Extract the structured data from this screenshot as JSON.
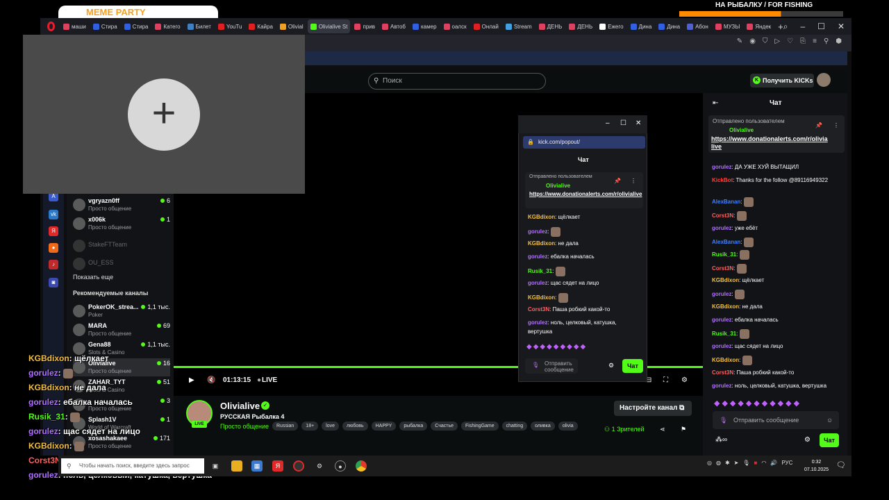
{
  "overlay": {
    "meme_party": "MEME PARTY",
    "fishing_label": "НА РЫБАЛКУ / FOR FISHING",
    "fishing_progress": 0.62
  },
  "browser": {
    "tabs": [
      {
        "label": "маши",
        "color": "#e04060"
      },
      {
        "label": "Стира",
        "color": "#3060e0"
      },
      {
        "label": "Стира",
        "color": "#3060e0"
      },
      {
        "label": "Катего",
        "color": "#e04060"
      },
      {
        "label": "Билет",
        "color": "#4080c0"
      },
      {
        "label": "YouTu",
        "color": "#e02020"
      },
      {
        "label": "Кайра",
        "color": "#e02020"
      },
      {
        "label": "Olivial",
        "color": "#f0a020"
      },
      {
        "label": "Olivialive St",
        "color": "#53fc18"
      },
      {
        "label": "прив",
        "color": "#e04060"
      },
      {
        "label": "Автоб",
        "color": "#e04060"
      },
      {
        "label": "камер",
        "color": "#3060e0"
      },
      {
        "label": "оалск",
        "color": "#e04060"
      },
      {
        "label": "Онлай",
        "color": "#e02020"
      },
      {
        "label": "Stream",
        "color": "#40a0e0"
      },
      {
        "label": "ДЕНЬ",
        "color": "#e04060"
      },
      {
        "label": "ДЕНЬ",
        "color": "#e04060"
      },
      {
        "label": "Ежего",
        "color": "#ffffff"
      },
      {
        "label": "Дина",
        "color": "#3060e0"
      },
      {
        "label": "Дина",
        "color": "#3060e0"
      },
      {
        "label": "Абон",
        "color": "#5060d0"
      },
      {
        "label": "МУЗЫ",
        "color": "#e04060"
      },
      {
        "label": "Яндек",
        "color": "#e04060"
      }
    ],
    "new_tab": "+"
  },
  "header": {
    "search_placeholder": "Поиск",
    "get_kicks": "Получить KICKs"
  },
  "sidebar": {
    "channels_top": [
      {
        "name": "vgryazn0ff",
        "cat": "Просто общение",
        "count": "6"
      },
      {
        "name": "x006k",
        "cat": "Просто общение",
        "count": "1"
      }
    ],
    "offline": [
      "StakeFTTeam",
      "OU_ESS"
    ],
    "show_more": "Показать еще",
    "recommended_title": "Рекомендуемые каналы",
    "recommended": [
      {
        "name": "PokerOK_strea...",
        "cat": "Poker",
        "count": "1,1 тыс."
      },
      {
        "name": "MARA",
        "cat": "Просто общение",
        "count": "69"
      },
      {
        "name": "Gena88",
        "cat": "Slots & Casino",
        "count": "1,1 тыс."
      },
      {
        "name": "Olivialive",
        "cat": "Просто общение",
        "count": "16"
      },
      {
        "name": "ZAHAR_TYT",
        "cat": "Slots & Casino",
        "count": "51"
      },
      {
        "name": "",
        "cat": "Просто общение",
        "count": "3"
      },
      {
        "name": "Splash1V",
        "cat": "World of Warcraft",
        "count": "1"
      },
      {
        "name": "xosashakaee",
        "cat": "Просто общение",
        "count": "171"
      }
    ]
  },
  "player": {
    "time": "01:13:15",
    "live": "LIVE"
  },
  "channel": {
    "name": "Olivialive",
    "title": "РУССКАЯ Рыбалка 4",
    "category": "Просто общение",
    "tags": [
      "Russian",
      "18+",
      "love",
      "любовь",
      "HAPPY",
      "рыбалка",
      "Счастье",
      "FishingGame",
      "chatting",
      "оливка",
      "olivia"
    ],
    "setup_button": "Настройте канал",
    "viewers": "1 Зрителей",
    "live_badge": "LIVE"
  },
  "popout": {
    "url": "kick.com/popout/",
    "chat_title": "Чат",
    "pinned_by": "Отправлено пользователем",
    "pinned_user": "Olivialive",
    "pinned_link": "https://www.donationalerts.com/r/olivialive",
    "messages": [
      {
        "user": "KGBdixon",
        "color": "#f4c040",
        "text": ": щёлкает"
      },
      {
        "user": "gorulez",
        "color": "#b070ff",
        "text": ":"
      },
      {
        "user": "KGBdixon",
        "color": "#f4c040",
        "text": ": не дала"
      },
      {
        "user": "gorulez",
        "color": "#b070ff",
        "text": ": ебалка началась"
      },
      {
        "user": "Rusik_31",
        "color": "#53fc18",
        "text": ":"
      },
      {
        "user": "gorulez",
        "color": "#b070ff",
        "text": ": щас сядет на лицо"
      },
      {
        "user": "KGBdixon",
        "color": "#f4c040",
        "text": ":"
      },
      {
        "user": "Corst3N",
        "color": "#ff6060",
        "text": ": Паша робкий какой-то"
      },
      {
        "user": "gorulez",
        "color": "#b070ff",
        "text": ": ноль, целковый, катушка,"
      },
      {
        "user": "",
        "color": "#ffffff",
        "text": "вертушка"
      }
    ],
    "send_placeholder": "Отправить сообщение",
    "chat_button": "Чат"
  },
  "chat": {
    "title": "Чат",
    "pinned_by": "Отправлено пользователем",
    "pinned_user": "Olivialive",
    "pinned_link": "https://www.donationalerts.com/r/olivia live",
    "messages": [
      {
        "user": "gorulez",
        "color": "#b070ff",
        "text": ": ДА УЖЕ ХУЙ ВЫТАЩИЛ"
      },
      {
        "user": "KickBot",
        "color": "#ff4040",
        "text": ": Thanks for the follow @89116949322"
      },
      {
        "user": "AlexBanan",
        "color": "#4080ff",
        "text": ":"
      },
      {
        "user": "Corst3N",
        "color": "#ff6060",
        "text": ":"
      },
      {
        "user": "gorulez",
        "color": "#b070ff",
        "text": ": уже ебёт"
      },
      {
        "user": "AlexBanan",
        "color": "#4080ff",
        "text": ":"
      },
      {
        "user": "Rusik_31",
        "color": "#53fc18",
        "text": ":"
      },
      {
        "user": "Corst3N",
        "color": "#ff6060",
        "text": ":"
      },
      {
        "user": "KGBdixon",
        "color": "#f4c040",
        "text": ": щёлкает"
      },
      {
        "user": "gorulez",
        "color": "#b070ff",
        "text": ":"
      },
      {
        "user": "KGBdixon",
        "color": "#f4c040",
        "text": ": не дала"
      },
      {
        "user": "gorulez",
        "color": "#b070ff",
        "text": ": ебалка началась"
      },
      {
        "user": "Rusik_31",
        "color": "#53fc18",
        "text": ":"
      },
      {
        "user": "gorulez",
        "color": "#b070ff",
        "text": ": щас сядет на лицо"
      },
      {
        "user": "KGBdixon",
        "color": "#f4c040",
        "text": ":"
      },
      {
        "user": "Corst3N",
        "color": "#ff6060",
        "text": ": Паша робкий какой-то"
      },
      {
        "user": "gorulez",
        "color": "#b070ff",
        "text": ": ноль, целковый, катушка, вертушка"
      }
    ],
    "send_placeholder": "Отправить сообщение",
    "chat_button": "Чат"
  },
  "stream_overlay_chat": [
    {
      "user": "KGBdixon",
      "color": "#f4c040",
      "text": ": щёлкает"
    },
    {
      "user": "gorulez",
      "color": "#b070ff",
      "text": ":"
    },
    {
      "user": "KGBdixon",
      "color": "#f4c040",
      "text": ": не дала"
    },
    {
      "user": "gorulez",
      "color": "#b070ff",
      "text": ": ебалка началась"
    },
    {
      "user": "Rusik_31",
      "color": "#53fc18",
      "text": ":"
    },
    {
      "user": "gorulez",
      "color": "#b070ff",
      "text": ": щас сядет на лицо"
    },
    {
      "user": "KGBdixon",
      "color": "#f4c040",
      "text": ":"
    },
    {
      "user": "Corst3N",
      "color": "#ff6060",
      "text": ": паша робкий какой-то"
    },
    {
      "user": "gorulez",
      "color": "#b070ff",
      "text": ": ноль, целковый, катушка, вертушка"
    }
  ],
  "taskbar": {
    "search_placeholder": "Чтобы начать поиск, введите здесь запрос",
    "lang": "РУС",
    "time": "0:32",
    "date": "07.10.2025"
  }
}
